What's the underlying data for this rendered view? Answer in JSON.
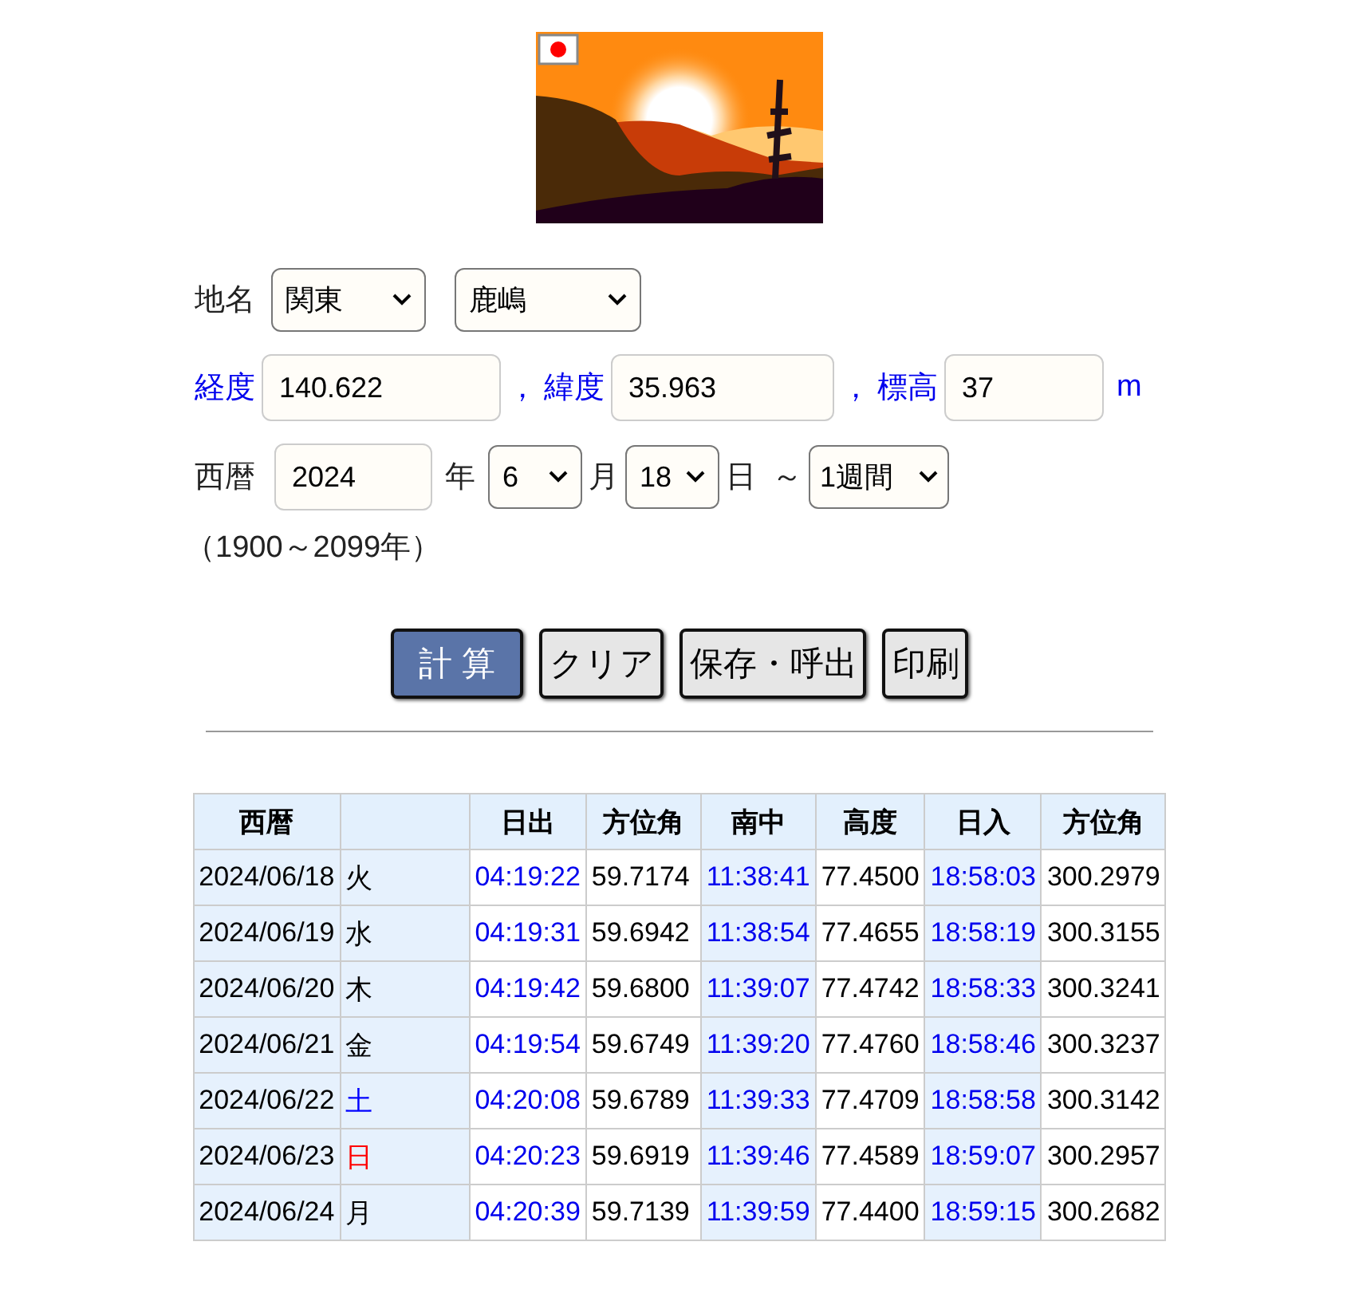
{
  "location": {
    "label": "地名",
    "region": "関東",
    "place": "鹿嶋"
  },
  "coords": {
    "longitude_label": "経度",
    "longitude": "140.622",
    "sep1": "，",
    "latitude_label": "緯度",
    "latitude": "35.963",
    "sep2": "，",
    "elevation_label": "標高",
    "elevation": "37",
    "unit": "m"
  },
  "date": {
    "label": "西暦",
    "year": "2024",
    "year_unit": "年",
    "month": "6",
    "month_unit": "月",
    "day": "18",
    "day_unit": "日",
    "tilde": "～",
    "period": "1週間",
    "range_note": "（1900～2099年）"
  },
  "buttons": [
    {
      "label": "計 算",
      "kind": "primary"
    },
    {
      "label": "クリア",
      "kind": "normal"
    },
    {
      "label": "保存・呼出",
      "kind": "normal"
    },
    {
      "label": "印刷",
      "kind": "normal"
    }
  ],
  "table": {
    "columns": [
      "西暦",
      "日出",
      "方位角",
      "南中",
      "高度",
      "日入",
      "方位角"
    ],
    "rows": [
      {
        "date": "2024/06/18",
        "weekday": "火",
        "color": "#000000",
        "sunrise": "04:19:22",
        "rise_azimuth": "59.7174",
        "transit": "11:38:41",
        "altitude": "77.4500",
        "sunset": "18:58:03",
        "set_azimuth": "300.2979"
      },
      {
        "date": "2024/06/19",
        "weekday": "水",
        "color": "#000000",
        "sunrise": "04:19:31",
        "rise_azimuth": "59.6942",
        "transit": "11:38:54",
        "altitude": "77.4655",
        "sunset": "18:58:19",
        "set_azimuth": "300.3155"
      },
      {
        "date": "2024/06/20",
        "weekday": "木",
        "color": "#000000",
        "sunrise": "04:19:42",
        "rise_azimuth": "59.6800",
        "transit": "11:39:07",
        "altitude": "77.4742",
        "sunset": "18:58:33",
        "set_azimuth": "300.3241"
      },
      {
        "date": "2024/06/21",
        "weekday": "金",
        "color": "#000000",
        "sunrise": "04:19:54",
        "rise_azimuth": "59.6749",
        "transit": "11:39:20",
        "altitude": "77.4760",
        "sunset": "18:58:46",
        "set_azimuth": "300.3237"
      },
      {
        "date": "2024/06/22",
        "weekday": "土",
        "color": "#0000ff",
        "sunrise": "04:20:08",
        "rise_azimuth": "59.6789",
        "transit": "11:39:33",
        "altitude": "77.4709",
        "sunset": "18:58:58",
        "set_azimuth": "300.3142"
      },
      {
        "date": "2024/06/23",
        "weekday": "日",
        "color": "#ff0000",
        "sunrise": "04:20:23",
        "rise_azimuth": "59.6919",
        "transit": "11:39:46",
        "altitude": "77.4589",
        "sunset": "18:59:07",
        "set_azimuth": "300.2957"
      },
      {
        "date": "2024/06/24",
        "weekday": "月",
        "color": "#000000",
        "sunrise": "04:20:39",
        "rise_azimuth": "59.7139",
        "transit": "11:39:59",
        "altitude": "77.4400",
        "sunset": "18:59:15",
        "set_azimuth": "300.2682"
      }
    ]
  }
}
